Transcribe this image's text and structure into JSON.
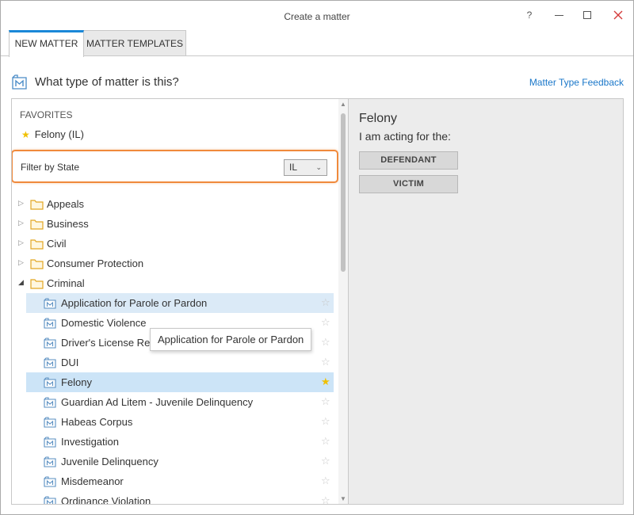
{
  "window": {
    "title": "Create a matter",
    "help_glyph": "?"
  },
  "tabs": [
    {
      "label": "NEW MATTER",
      "active": true
    },
    {
      "label": "MATTER TEMPLATES",
      "active": false
    }
  ],
  "header": {
    "question": "What type of matter is this?",
    "feedback_link": "Matter Type Feedback",
    "icon": "matter-icon"
  },
  "favorites": {
    "label": "FAVORITES",
    "items": [
      {
        "label": "Felony (IL)"
      }
    ]
  },
  "filter": {
    "label": "Filter by State",
    "selected": "IL"
  },
  "tree": {
    "folders": [
      {
        "label": "Appeals",
        "expanded": false
      },
      {
        "label": "Business",
        "expanded": false
      },
      {
        "label": "Civil",
        "expanded": false
      },
      {
        "label": "Consumer Protection",
        "expanded": false
      },
      {
        "label": "Criminal",
        "expanded": true
      }
    ],
    "criminal_items": [
      {
        "label": "Application for Parole or Pardon",
        "favorite": false,
        "state": "hovered"
      },
      {
        "label": "Domestic Violence",
        "favorite": false,
        "state": ""
      },
      {
        "label": "Driver's License Rei",
        "favorite": false,
        "state": ""
      },
      {
        "label": "DUI",
        "favorite": false,
        "state": ""
      },
      {
        "label": "Felony",
        "favorite": true,
        "state": "selected"
      },
      {
        "label": "Guardian Ad Litem - Juvenile Delinquency",
        "favorite": false,
        "state": ""
      },
      {
        "label": "Habeas Corpus",
        "favorite": false,
        "state": ""
      },
      {
        "label": "Investigation",
        "favorite": false,
        "state": ""
      },
      {
        "label": "Juvenile Delinquency",
        "favorite": false,
        "state": ""
      },
      {
        "label": "Misdemeanor",
        "favorite": false,
        "state": ""
      },
      {
        "label": "Ordinance Violation",
        "favorite": false,
        "state": ""
      }
    ]
  },
  "tooltip": {
    "text": "Application for Parole or Pardon"
  },
  "detail": {
    "title": "Felony",
    "subtitle": "I am acting for the:",
    "buttons": [
      "DEFENDANT",
      "VICTIM"
    ]
  },
  "colors": {
    "accent": "#1a88d8",
    "link": "#1a77c9",
    "filter_highlight": "#f08a3c",
    "star_on": "#f0c000",
    "selected_row": "#cce4f7"
  }
}
